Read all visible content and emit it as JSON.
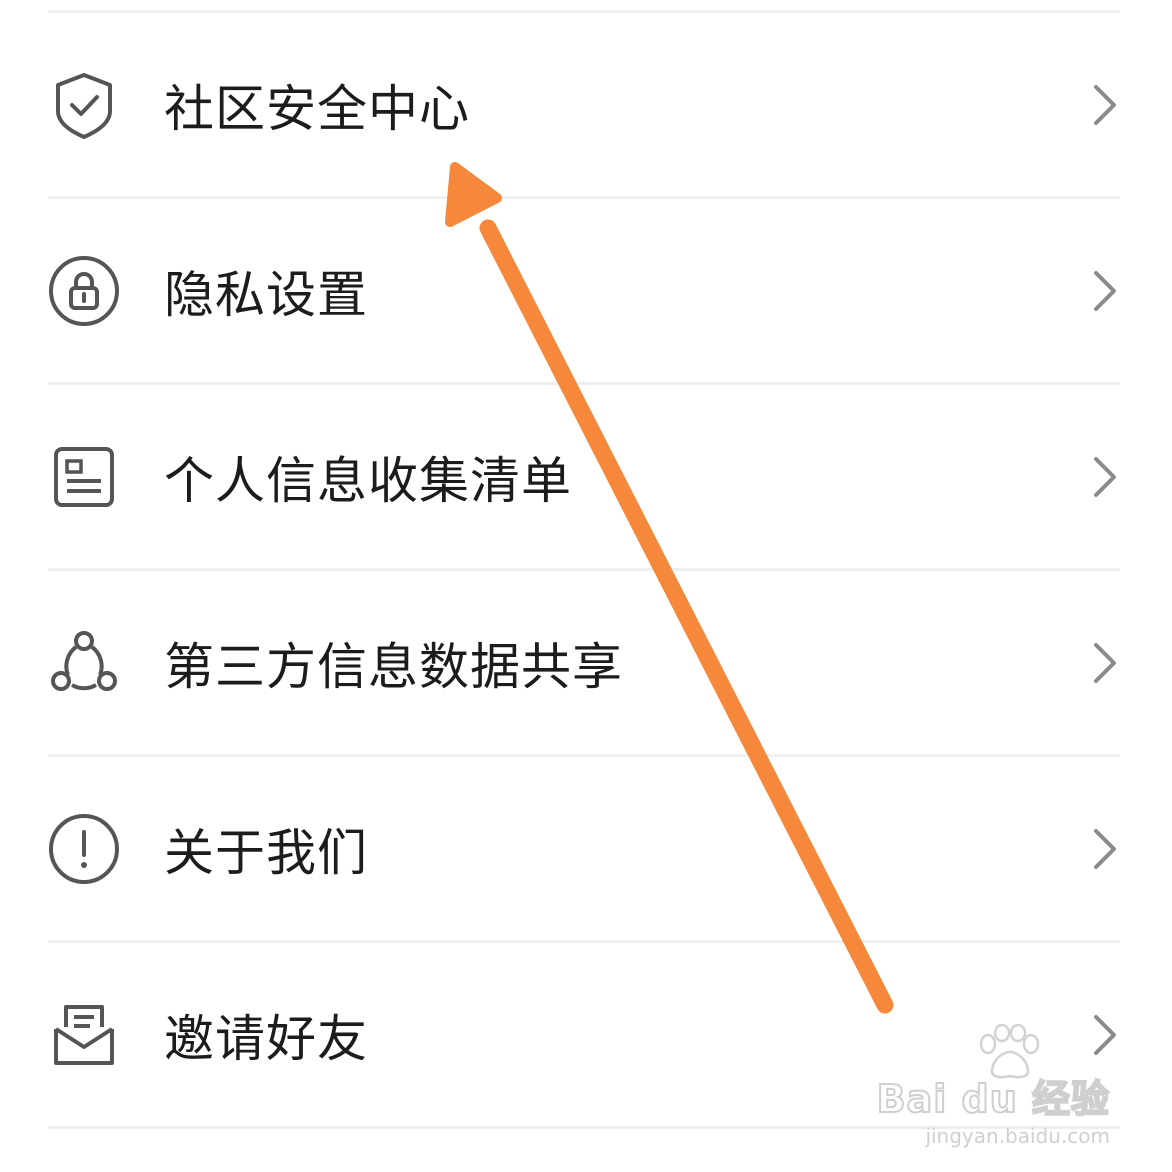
{
  "settings_list": {
    "items": [
      {
        "label": "社区安全中心",
        "icon": "shield-check-icon"
      },
      {
        "label": "隐私设置",
        "icon": "lock-icon"
      },
      {
        "label": "个人信息收集清单",
        "icon": "id-card-icon"
      },
      {
        "label": "第三方信息数据共享",
        "icon": "share-network-icon"
      },
      {
        "label": "关于我们",
        "icon": "info-exclamation-icon"
      },
      {
        "label": "邀请好友",
        "icon": "invite-envelope-icon"
      }
    ],
    "chevron_icon": "chevron-right-icon"
  },
  "annotation": {
    "arrow_color": "#f5883a",
    "points_to": "社区安全中心"
  },
  "watermark": {
    "brand": "Bai du 经验",
    "url": "jingyan.baidu.com"
  },
  "colors": {
    "text": "#1c1c1c",
    "icon_stroke": "#555555",
    "divider": "#efefef",
    "chevron": "#8a8a8a"
  }
}
